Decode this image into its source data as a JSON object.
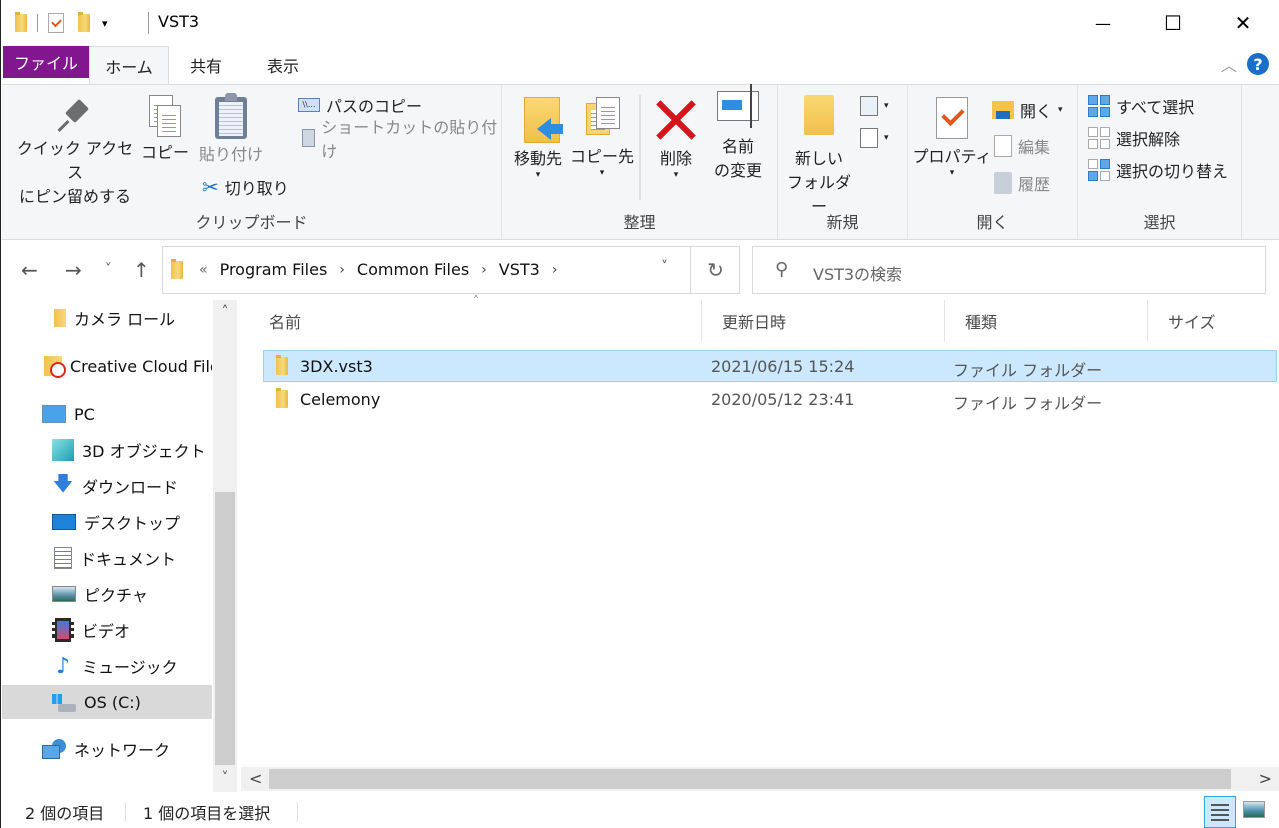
{
  "window": {
    "title": "VST3",
    "controls": {
      "minimize": "—",
      "maximize": "☐",
      "close": "✕"
    }
  },
  "quick_access_toolbar": {
    "icons": [
      "folder-icon",
      "properties-icon",
      "new-folder-icon",
      "customize-dropdown-icon"
    ],
    "dropdown_glyph": "▾"
  },
  "tabs": [
    {
      "label": "ファイル",
      "active": false
    },
    {
      "label": "ホーム",
      "active": true
    },
    {
      "label": "共有",
      "active": false
    },
    {
      "label": "表示",
      "active": false
    }
  ],
  "help": {
    "glyph": "?",
    "collapse_glyph": "︿"
  },
  "ribbon": {
    "clipboard": {
      "label": "クリップボード",
      "pin_line1": "クイック アクセス",
      "pin_line2": "にピン留めする",
      "copy": "コピー",
      "paste": "貼り付け",
      "cut": "切り取り",
      "copy_path": "パスのコピー",
      "paste_shortcut": "ショートカットの貼り付け",
      "path_icon_text": "\\\\..."
    },
    "organize": {
      "label": "整理",
      "move_to": "移動先",
      "copy_to": "コピー先",
      "delete": "削除",
      "rename_line1": "名前",
      "rename_line2": "の変更"
    },
    "new": {
      "label": "新規",
      "new_folder_line1": "新しい",
      "new_folder_line2": "フォルダー"
    },
    "open": {
      "label": "開く",
      "properties": "プロパティ",
      "open": "開く",
      "edit": "編集",
      "history": "履歴"
    },
    "select": {
      "label": "選択",
      "select_all": "すべて選択",
      "select_none": "選択解除",
      "invert_selection": "選択の切り替え"
    },
    "dropdown_glyph": "▾"
  },
  "navigation": {
    "back": "←",
    "forward": "→",
    "recent": "˅",
    "up": "↑",
    "address": {
      "overflow": "«",
      "crumbs": [
        "Program Files",
        "Common Files",
        "VST3"
      ],
      "separator": "›",
      "dropdown": "˅",
      "refresh": "↻"
    },
    "search": {
      "placeholder": "VST3の検索",
      "icon": "⚲"
    }
  },
  "nav_pane": {
    "items": [
      {
        "label": "カメラ ロール",
        "icon": "folder-icon"
      },
      {
        "label": "Creative Cloud Files",
        "icon": "creative-cloud-folder-icon"
      },
      {
        "label": "PC",
        "icon": "pc-icon"
      },
      {
        "label": "3D オブジェクト",
        "icon": "3d-objects-icon"
      },
      {
        "label": "ダウンロード",
        "icon": "downloads-icon"
      },
      {
        "label": "デスクトップ",
        "icon": "desktop-icon"
      },
      {
        "label": "ドキュメント",
        "icon": "documents-icon"
      },
      {
        "label": "ピクチャ",
        "icon": "pictures-icon"
      },
      {
        "label": "ビデオ",
        "icon": "videos-icon"
      },
      {
        "label": "ミュージック",
        "icon": "music-icon"
      },
      {
        "label": "OS (C:)",
        "icon": "drive-icon",
        "selected": true
      },
      {
        "label": "ネットワーク",
        "icon": "network-icon"
      }
    ],
    "scroll_up": "˄",
    "scroll_down": "˅"
  },
  "file_list": {
    "sort_indicator": "˄",
    "columns": [
      "名前",
      "更新日時",
      "種類",
      "サイズ"
    ],
    "rows": [
      {
        "name": "3DX.vst3",
        "modified": "2021/06/15 15:24",
        "type": "ファイル フォルダー",
        "size": "",
        "selected": true
      },
      {
        "name": "Celemony",
        "modified": "2020/05/12 23:41",
        "type": "ファイル フォルダー",
        "size": "",
        "selected": false
      }
    ],
    "scroll_left": "<",
    "scroll_right": ">"
  },
  "status_bar": {
    "item_count": "2 個の項目",
    "selected_count": "1 個の項目を選択",
    "view_details_active": true
  }
}
